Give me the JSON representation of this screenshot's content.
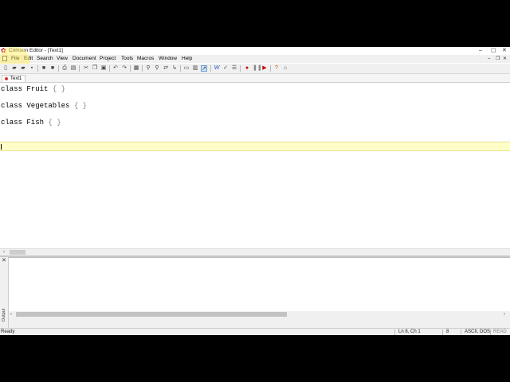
{
  "window": {
    "title": "Crimson Editor - [Text1]"
  },
  "menu": [
    "File",
    "Edit",
    "Search",
    "View",
    "Document",
    "Project",
    "Tools",
    "Macros",
    "Window",
    "Help"
  ],
  "toolbar_icons": [
    "new-file-icon",
    "open-file-icon",
    "open-remote-icon",
    "save-all-icon",
    "save-icon",
    "save-as-icon",
    "print-icon",
    "print-preview-icon",
    "cut-icon",
    "copy-icon",
    "paste-icon",
    "undo-icon",
    "redo-icon",
    "delete-icon",
    "select-all-icon",
    "find-icon",
    "find-next-icon",
    "replace-icon",
    "goto-icon",
    "new-window-icon",
    "split-icon",
    "word-wrap-icon",
    "spell-check-icon",
    "column-mode-icon",
    "record-macro-icon",
    "pause-macro-icon",
    "play-macro-icon",
    "help-icon",
    "home-icon"
  ],
  "tab": {
    "label": "Text1",
    "modified_color": "#dd3333"
  },
  "editor": {
    "lines": [
      {
        "kw": "class Fruit ",
        "brace": "{ }"
      },
      {
        "kw": "class Vegetables ",
        "brace": "{ }"
      },
      {
        "kw": "class Fish ",
        "brace": "{ }"
      }
    ],
    "current_line_color": "#ffffc8"
  },
  "output": {
    "label": "Output"
  },
  "status": {
    "message": "Ready",
    "position": "Ln 8, Ch 1",
    "column": "8",
    "encoding": "ASCII, DOS",
    "mode": "READ"
  }
}
